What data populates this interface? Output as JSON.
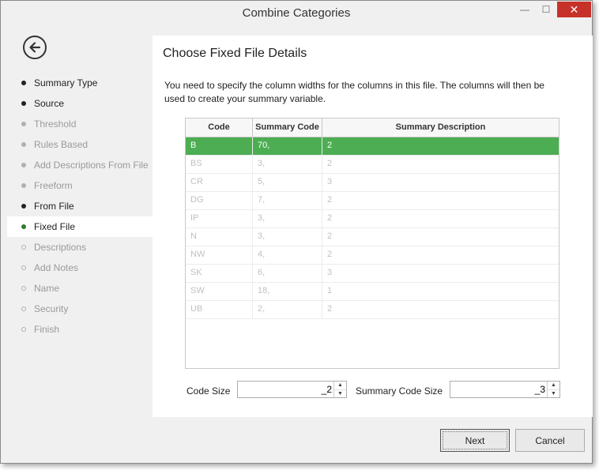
{
  "window": {
    "title": "Combine Categories",
    "minimize_glyph": "—",
    "maximize_glyph": "☐",
    "close_glyph": "✕"
  },
  "sidebar": {
    "back_icon": "arrow-left-circle-icon",
    "items": [
      {
        "label": "Summary Type",
        "state": "done"
      },
      {
        "label": "Source",
        "state": "done"
      },
      {
        "label": "Threshold",
        "state": "skipped"
      },
      {
        "label": "Rules Based",
        "state": "skipped"
      },
      {
        "label": "Add Descriptions From File",
        "state": "skipped"
      },
      {
        "label": "Freeform",
        "state": "skipped"
      },
      {
        "label": "From File",
        "state": "done"
      },
      {
        "label": "Fixed File",
        "state": "active"
      },
      {
        "label": "Descriptions",
        "state": "todo"
      },
      {
        "label": "Add Notes",
        "state": "todo"
      },
      {
        "label": "Name",
        "state": "todo"
      },
      {
        "label": "Security",
        "state": "todo"
      },
      {
        "label": "Finish",
        "state": "todo"
      }
    ]
  },
  "main": {
    "title": "Choose Fixed File Details",
    "instructions": "You need to specify the column widths for the columns in this file. The columns will then be used to create your summary variable.",
    "grid": {
      "columns": [
        "Code",
        "Summary Code",
        "Summary Description"
      ],
      "rows": [
        {
          "code": "B",
          "summary_code": "70,",
          "summary_description": "2",
          "selected": true
        },
        {
          "code": "BS",
          "summary_code": "3,",
          "summary_description": "2",
          "selected": false
        },
        {
          "code": "CR",
          "summary_code": "5,",
          "summary_description": "3",
          "selected": false
        },
        {
          "code": "DG",
          "summary_code": "7,",
          "summary_description": "2",
          "selected": false
        },
        {
          "code": "IP",
          "summary_code": "3,",
          "summary_description": "2",
          "selected": false
        },
        {
          "code": "N",
          "summary_code": "3,",
          "summary_description": "2",
          "selected": false
        },
        {
          "code": "NW",
          "summary_code": "4,",
          "summary_description": "2",
          "selected": false
        },
        {
          "code": "SK",
          "summary_code": "6,",
          "summary_description": "3",
          "selected": false
        },
        {
          "code": "SW",
          "summary_code": "18,",
          "summary_description": "1",
          "selected": false
        },
        {
          "code": "UB",
          "summary_code": "2,",
          "summary_description": "2",
          "selected": false
        }
      ]
    },
    "code_size": {
      "label": "Code Size",
      "value": "_2"
    },
    "summary_code_size": {
      "label": "Summary Code Size",
      "value": "_3"
    }
  },
  "footer": {
    "next_label": "Next",
    "cancel_label": "Cancel"
  },
  "colors": {
    "selected_row": "#4cad52",
    "active_bullet": "#2e7d32",
    "close_button": "#c7312a"
  }
}
